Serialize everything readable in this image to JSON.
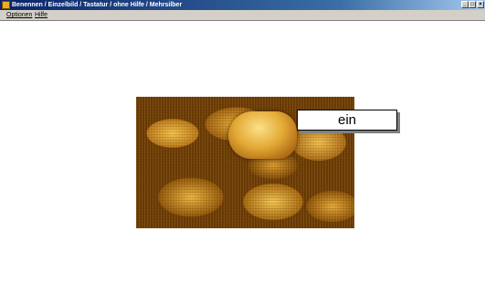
{
  "window": {
    "title": "Benennen / Einzelbild / Tastatur / ohne Hilfe / Mehrsilber",
    "controls": {
      "minimize": "_",
      "maximize": "□",
      "close": "×"
    }
  },
  "menu": {
    "items": [
      {
        "label": "Optionen"
      },
      {
        "label": "Hilfe"
      }
    ]
  },
  "exercise": {
    "picture_icon": "bread-roll-photo",
    "answer": "ein"
  }
}
